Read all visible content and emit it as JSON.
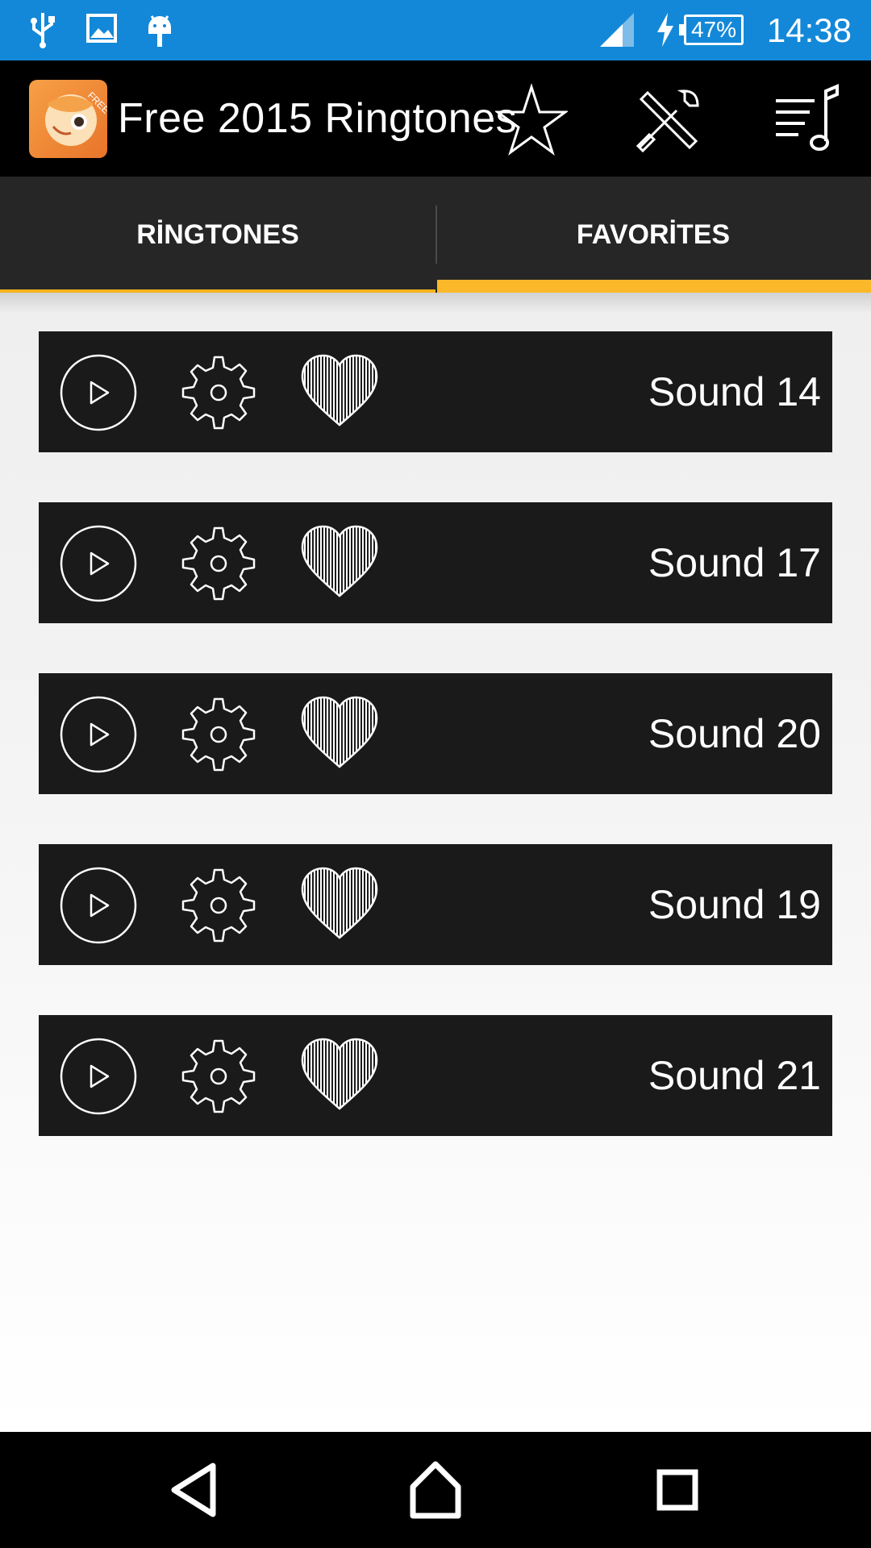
{
  "status_bar": {
    "left_icons": [
      "usb-icon",
      "image-icon",
      "android-icon"
    ],
    "right_icons": [
      "signal-icon",
      "charging-icon"
    ],
    "battery": "47%",
    "time": "14:38",
    "color": "#1488d8"
  },
  "action_bar": {
    "title": "Free 2015 Ringtones",
    "logo_badge": "FREE",
    "actions": [
      "star-icon",
      "tools-icon",
      "music-list-icon"
    ]
  },
  "tabs": [
    {
      "label": "RİNGTONES",
      "selected": false
    },
    {
      "label": "FAVORİTES",
      "selected": true
    }
  ],
  "accent_color": "#fbb829",
  "favorites": [
    {
      "name": "Sound 14"
    },
    {
      "name": "Sound 17"
    },
    {
      "name": "Sound 20"
    },
    {
      "name": "Sound 19"
    },
    {
      "name": "Sound 21"
    }
  ],
  "nav_bar": {
    "buttons": [
      "back-icon",
      "home-icon",
      "recents-icon"
    ]
  }
}
